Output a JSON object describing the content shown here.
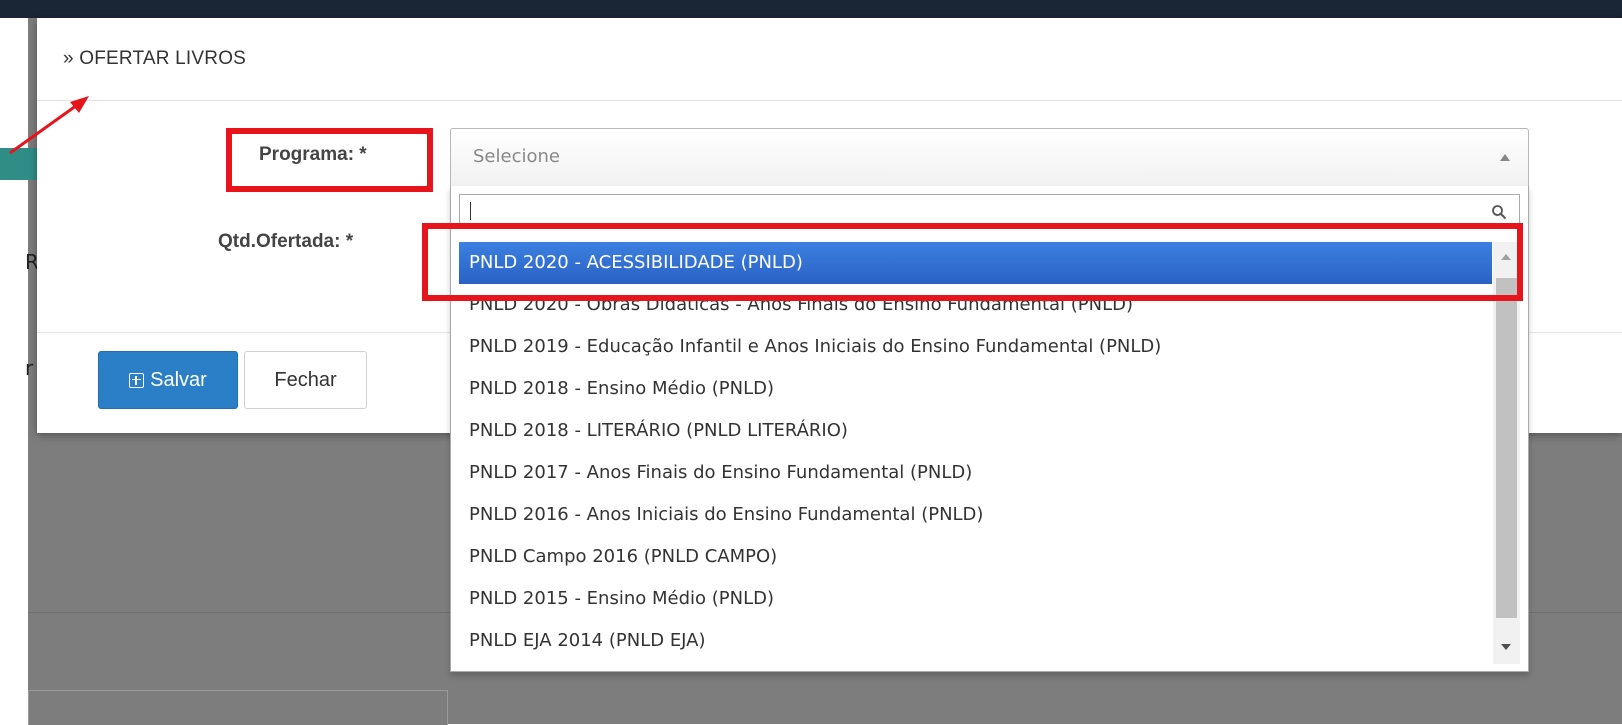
{
  "modal": {
    "title": "» OFERTAR LIVROS",
    "programa_label": "Programa: *",
    "qtd_label": "Qtd.Ofertada: *",
    "save_label": "Salvar",
    "close_label": "Fechar"
  },
  "select": {
    "placeholder": "Selecione",
    "search_value": ""
  },
  "options": [
    "PNLD 2020 - ACESSIBILIDADE (PNLD)",
    "PNLD 2020 - Obras Didáticas - Anos Finais do Ensino Fundamental (PNLD)",
    "PNLD 2019 - Educação Infantil e Anos Iniciais do Ensino Fundamental (PNLD)",
    "PNLD 2018 - Ensino Médio (PNLD)",
    "PNLD 2018 - LITERÁRIO (PNLD LITERÁRIO)",
    "PNLD 2017 - Anos Finais do Ensino Fundamental (PNLD)",
    "PNLD 2016 - Anos Iniciais do Ensino Fundamental (PNLD)",
    "PNLD Campo 2016 (PNLD CAMPO)",
    "PNLD 2015 - Ensino Médio (PNLD)",
    "PNLD EJA 2014 (PNLD EJA)"
  ],
  "selected_option": "PNLD 2020 - ACESSIBILIDADE (PNLD)",
  "background": {
    "frag_r": "R",
    "frag_r2": "r"
  },
  "colors": {
    "annotation_red": "#e8141c",
    "highlight_blue": "#3875d7",
    "save_button": "#2a7fc6"
  },
  "icons": [
    "search-icon",
    "plus-square-icon",
    "arrow-up-icon",
    "scroll-up-icon",
    "scroll-down-icon"
  ]
}
